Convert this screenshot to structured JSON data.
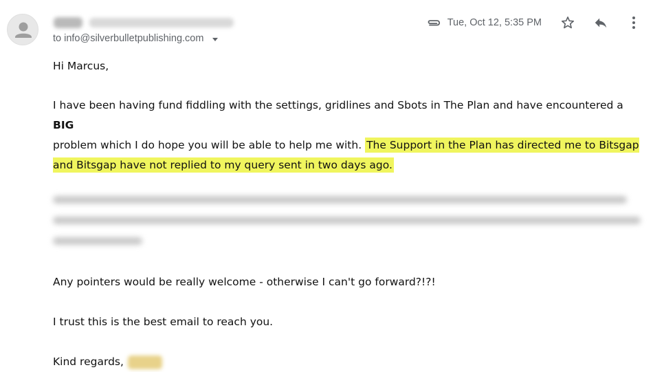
{
  "header": {
    "recipient": "to info@silverbulletpublishing.com",
    "date": "Tue, Oct 12, 5:35 PM",
    "icons": {
      "avatar": "person-avatar-icon",
      "attachment": "paperclip-icon",
      "star": "star-icon",
      "reply": "reply-icon",
      "more": "more-vert-icon",
      "recipient_details": "chevron-down-icon"
    }
  },
  "message": {
    "greeting": "Hi Marcus,",
    "para1_start": "I have been having fund fiddling with the settings, gridlines and Sbots in The Plan and have encountered a ",
    "para1_bold": "BIG",
    "para1_line2": "problem which I do hope you will be able to help me with. ",
    "para1_highlight": " The Support in the Plan has directed me to Bitsgap and Bitsgap have not replied to my query sent in two days ago.",
    "para3": "Any pointers would be really welcome - otherwise I can't go forward?!?!",
    "para4": "I trust this is the best email to reach you.",
    "signoff": "Kind regards,"
  },
  "colors": {
    "highlight": "#f0f55e",
    "meta_text": "#5f6368"
  }
}
